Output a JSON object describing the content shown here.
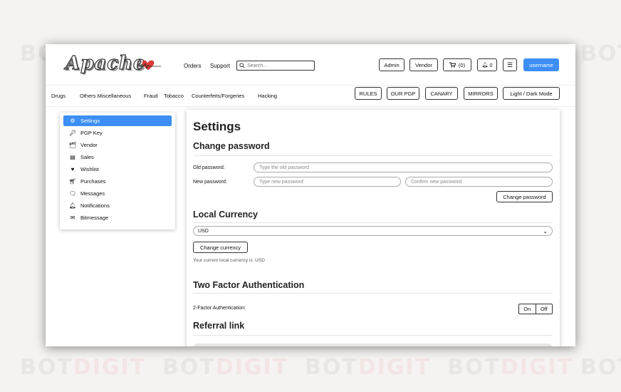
{
  "watermark": {
    "part1": "BOT",
    "part2": "DIGIT"
  },
  "logo": {
    "text": "Apache"
  },
  "header": {
    "nav": [
      "Orders",
      "Support"
    ],
    "search_placeholder": "Search...",
    "buttons": {
      "admin": "Admin",
      "vendor": "Vendor",
      "cart": "(0)",
      "notifications": "0",
      "username": "username"
    }
  },
  "categories": [
    "Drugs",
    "Others Miscellaneous",
    "Fraud",
    "Tobacco",
    "Counterfeits/Forgeries",
    "Hacking"
  ],
  "top_buttons": {
    "rules": "RULES",
    "our_pgp": "OUR PGP",
    "canary": "CANARY",
    "mirrors": "MIRRORS",
    "theme": "Light / Dark Mode"
  },
  "sidebar": {
    "items": [
      {
        "label": "Settings",
        "icon": "gear-icon",
        "active": true
      },
      {
        "label": "PGP Key",
        "icon": "key-icon"
      },
      {
        "label": "Vendor",
        "icon": "id-card-icon"
      },
      {
        "label": "Sales",
        "icon": "ledger-icon"
      },
      {
        "label": "Wishlist",
        "icon": "heart-icon"
      },
      {
        "label": "Purchases",
        "icon": "cart-icon"
      },
      {
        "label": "Messages",
        "icon": "messages-icon"
      },
      {
        "label": "Notifications",
        "icon": "bell-icon"
      },
      {
        "label": "Bitmessage",
        "icon": "envelope-icon"
      }
    ]
  },
  "settings": {
    "title": "Settings",
    "password": {
      "heading": "Change password",
      "old_label": "Old password:",
      "old_placeholder": "Type the old password",
      "new_label": "New password:",
      "new_placeholder": "Type new password",
      "confirm_placeholder": "Confirm new password",
      "button": "Change password"
    },
    "currency": {
      "heading": "Local Currency",
      "selected": "USD",
      "button": "Change currency",
      "note": "Your current local currency is: USD"
    },
    "two_factor": {
      "heading": "Two Factor Authentication",
      "label": "2-Factor Authentication:",
      "on": "On",
      "off": "Off"
    },
    "referral": {
      "heading": "Referral link"
    }
  },
  "colors": {
    "accent": "#3d8ef5",
    "watermark_red": "#dc3c3c"
  }
}
